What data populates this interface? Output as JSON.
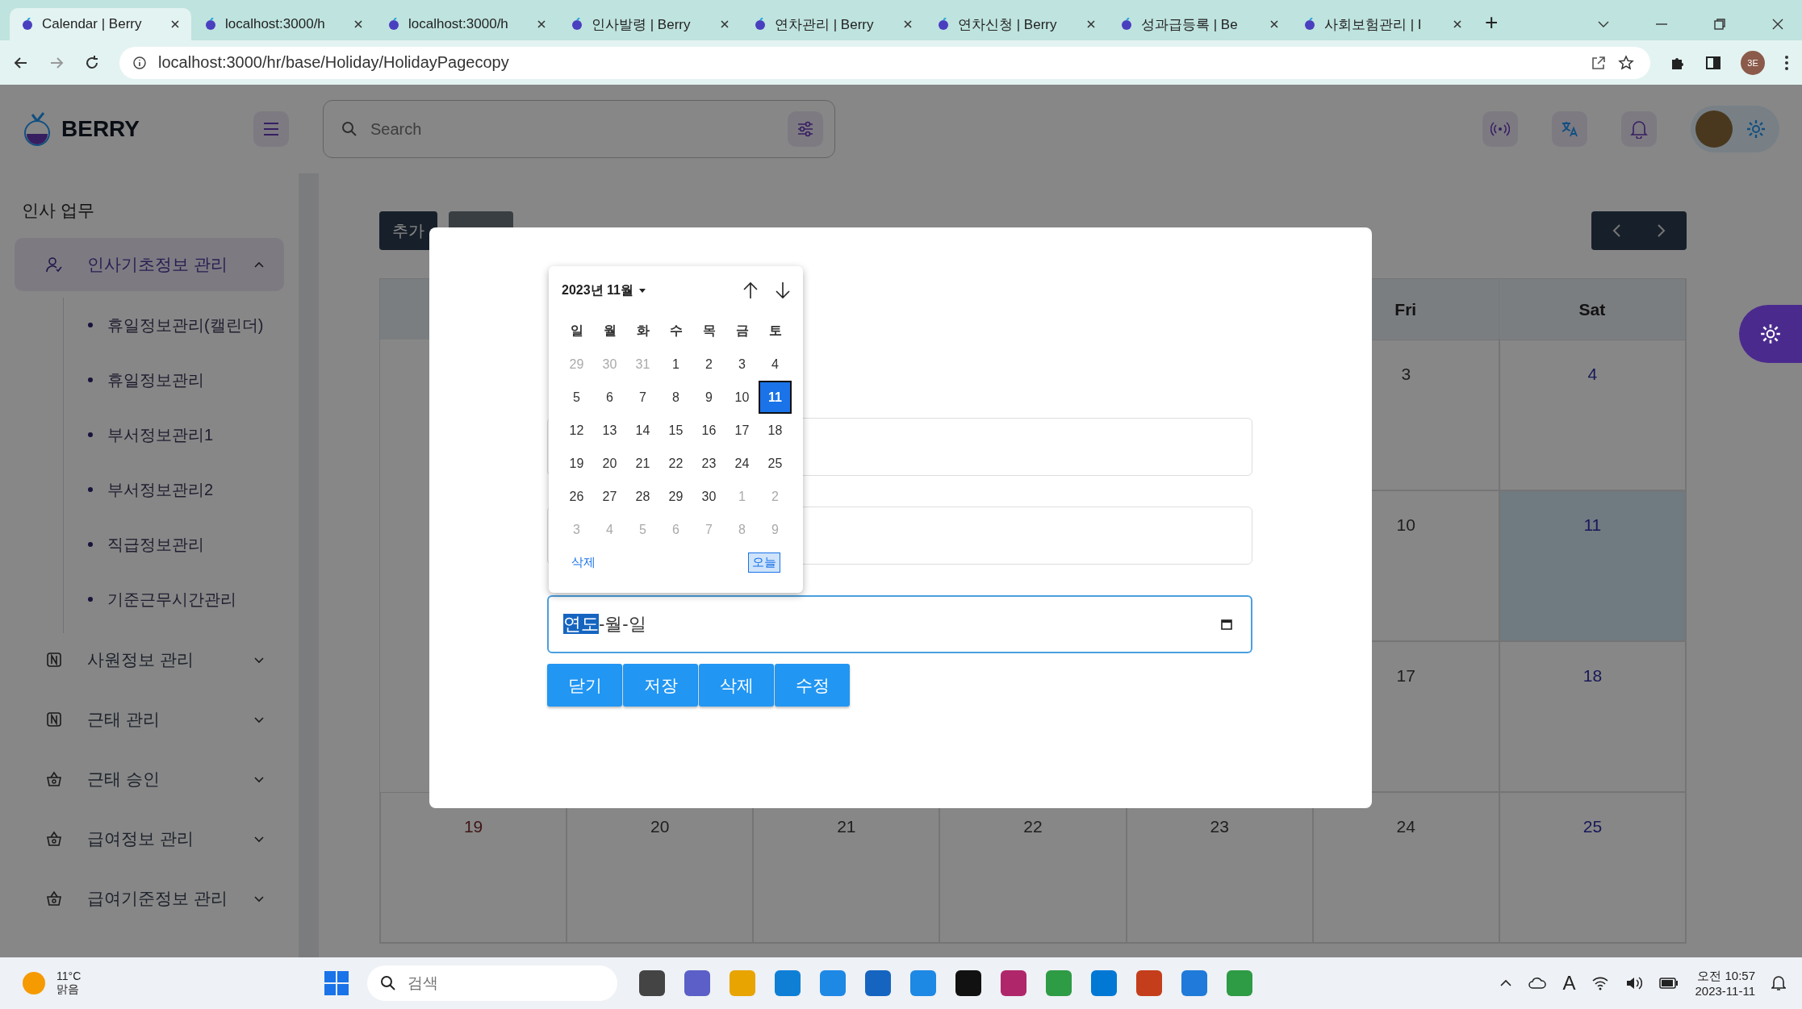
{
  "browser": {
    "tabs": [
      {
        "title": "Calendar | Berry",
        "selected": true
      },
      {
        "title": "localhost:3000/h",
        "selected": false
      },
      {
        "title": "localhost:3000/h",
        "selected": false
      },
      {
        "title": "인사발령 | Berry",
        "selected": false
      },
      {
        "title": "연차관리 | Berry",
        "selected": false
      },
      {
        "title": "연차신청 | Berry",
        "selected": false
      },
      {
        "title": "성과급등록 | Be",
        "selected": false
      },
      {
        "title": "사회보험관리 | I",
        "selected": false
      }
    ],
    "new_tab": "+",
    "address": "localhost:3000/hr/base/Holiday/HolidayPagecopy",
    "profile": "3E"
  },
  "header": {
    "brand": "BERRY",
    "search": {
      "placeholder": "Search"
    }
  },
  "sidebar": {
    "section": "인사 업무",
    "groups": [
      {
        "label": "인사기초정보 관리",
        "kind": "user",
        "expanded": true,
        "children": [
          {
            "label": "휴일정보관리(캘린더)"
          },
          {
            "label": "휴일정보관리"
          },
          {
            "label": "부서정보관리1"
          },
          {
            "label": "부서정보관리2"
          },
          {
            "label": "직급정보관리"
          },
          {
            "label": "기준근무시간관리"
          }
        ]
      },
      {
        "label": "사원정보 관리",
        "kind": "card",
        "expanded": false
      },
      {
        "label": "근태 관리",
        "kind": "card",
        "expanded": false
      },
      {
        "label": "근태 승인",
        "kind": "basket",
        "expanded": false
      },
      {
        "label": "급여정보 관리",
        "kind": "basket",
        "expanded": false
      },
      {
        "label": "급여기준정보 관리",
        "kind": "basket",
        "expanded": false
      }
    ]
  },
  "calendar": {
    "add_button": "추가",
    "weekdays": [
      {
        "label": "Fri"
      },
      {
        "label": "Sat"
      }
    ],
    "weeks": [
      {
        "days": [
          {
            "label": "3",
            "kind": "weekday",
            "today": false
          },
          {
            "label": "4",
            "kind": "saturday",
            "today": false
          }
        ]
      },
      {
        "days": [
          {
            "label": "10",
            "kind": "weekday",
            "today": false
          },
          {
            "label": "11",
            "kind": "saturday",
            "today": true
          }
        ]
      },
      {
        "days": [
          {
            "label": "17",
            "kind": "weekday",
            "today": false
          },
          {
            "label": "18",
            "kind": "saturday",
            "today": false
          }
        ]
      },
      {
        "days": [
          {
            "label": "19",
            "kind": "sunday",
            "today": false
          },
          {
            "label": "20",
            "kind": "weekday",
            "today": false
          },
          {
            "label": "21",
            "kind": "weekday",
            "today": false
          },
          {
            "label": "22",
            "kind": "weekday",
            "today": false
          },
          {
            "label": "23",
            "kind": "weekday",
            "today": false
          },
          {
            "label": "24",
            "kind": "weekday",
            "today": false
          },
          {
            "label": "25",
            "kind": "saturday",
            "today": false
          }
        ]
      }
    ]
  },
  "dialog": {
    "fields": [
      {
        "kind": "text"
      },
      {
        "kind": "text"
      },
      {
        "kind": "date",
        "focused": true,
        "segments": [
          {
            "text": "연도",
            "selected": true
          },
          {
            "text": "-",
            "selected": false
          },
          {
            "text": "월",
            "selected": false
          },
          {
            "text": "-",
            "selected": false
          },
          {
            "text": "일",
            "selected": false
          }
        ]
      }
    ],
    "buttons": [
      {
        "label": "닫기"
      },
      {
        "label": "저장"
      },
      {
        "label": "삭제"
      },
      {
        "label": "수정"
      }
    ],
    "picker": {
      "title": "2023년 11월",
      "weekdays": [
        "일",
        "월",
        "화",
        "수",
        "목",
        "금",
        "토"
      ],
      "weeks": [
        [
          {
            "day": "29",
            "muted": true,
            "selected": false
          },
          {
            "day": "30",
            "muted": true,
            "selected": false
          },
          {
            "day": "31",
            "muted": true,
            "selected": false
          },
          {
            "day": "1",
            "muted": false,
            "selected": false
          },
          {
            "day": "2",
            "muted": false,
            "selected": false
          },
          {
            "day": "3",
            "muted": false,
            "selected": false
          },
          {
            "day": "4",
            "muted": false,
            "selected": false
          }
        ],
        [
          {
            "day": "5",
            "muted": false,
            "selected": false
          },
          {
            "day": "6",
            "muted": false,
            "selected": false
          },
          {
            "day": "7",
            "muted": false,
            "selected": false
          },
          {
            "day": "8",
            "muted": false,
            "selected": false
          },
          {
            "day": "9",
            "muted": false,
            "selected": false
          },
          {
            "day": "10",
            "muted": false,
            "selected": false
          },
          {
            "day": "11",
            "muted": false,
            "selected": true
          }
        ],
        [
          {
            "day": "12",
            "muted": false,
            "selected": false
          },
          {
            "day": "13",
            "muted": false,
            "selected": false
          },
          {
            "day": "14",
            "muted": false,
            "selected": false
          },
          {
            "day": "15",
            "muted": false,
            "selected": false
          },
          {
            "day": "16",
            "muted": false,
            "selected": false
          },
          {
            "day": "17",
            "muted": false,
            "selected": false
          },
          {
            "day": "18",
            "muted": false,
            "selected": false
          }
        ],
        [
          {
            "day": "19",
            "muted": false,
            "selected": false
          },
          {
            "day": "20",
            "muted": false,
            "selected": false
          },
          {
            "day": "21",
            "muted": false,
            "selected": false
          },
          {
            "day": "22",
            "muted": false,
            "selected": false
          },
          {
            "day": "23",
            "muted": false,
            "selected": false
          },
          {
            "day": "24",
            "muted": false,
            "selected": false
          },
          {
            "day": "25",
            "muted": false,
            "selected": false
          }
        ],
        [
          {
            "day": "26",
            "muted": false,
            "selected": false
          },
          {
            "day": "27",
            "muted": false,
            "selected": false
          },
          {
            "day": "28",
            "muted": false,
            "selected": false
          },
          {
            "day": "29",
            "muted": false,
            "selected": false
          },
          {
            "day": "30",
            "muted": false,
            "selected": false
          },
          {
            "day": "1",
            "muted": true,
            "selected": false
          },
          {
            "day": "2",
            "muted": true,
            "selected": false
          }
        ],
        [
          {
            "day": "3",
            "muted": true,
            "selected": false
          },
          {
            "day": "4",
            "muted": true,
            "selected": false
          },
          {
            "day": "5",
            "muted": true,
            "selected": false
          },
          {
            "day": "6",
            "muted": true,
            "selected": false
          },
          {
            "day": "7",
            "muted": true,
            "selected": false
          },
          {
            "day": "8",
            "muted": true,
            "selected": false
          },
          {
            "day": "9",
            "muted": true,
            "selected": false
          }
        ]
      ],
      "clear": "삭제",
      "today": "오늘"
    }
  },
  "taskbar": {
    "weather": {
      "temp": "11°C",
      "condition": "맑음"
    },
    "search": {
      "placeholder": "검색"
    },
    "tray_letter": "A",
    "clock": {
      "time": "오전 10:57",
      "date": "2023-11-11"
    }
  }
}
